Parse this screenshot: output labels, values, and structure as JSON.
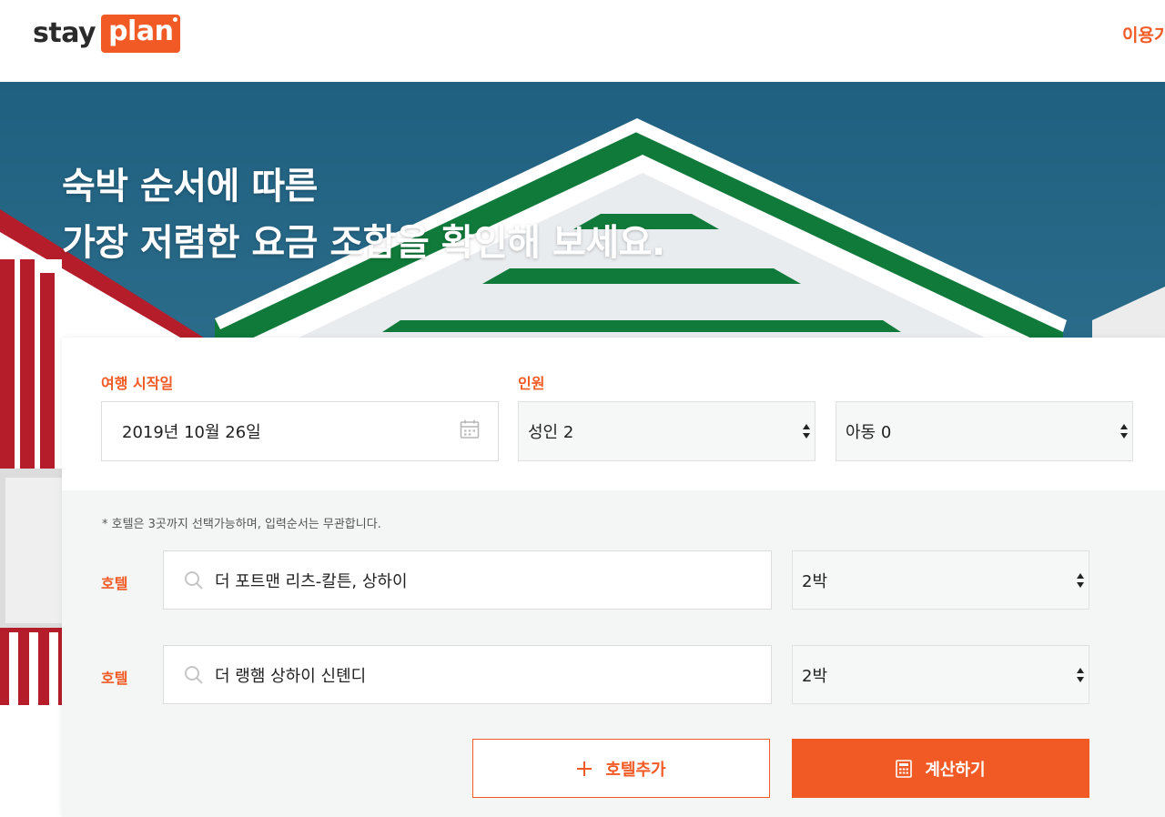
{
  "header": {
    "logo_text_1": "stay",
    "logo_text_2": "plan",
    "nav_link": "이용가"
  },
  "hero": {
    "title_line_1": "숙박 순서에 따른",
    "title_line_2": "가장 저렴한 요금 조합을 확인해 보세요."
  },
  "form": {
    "start_date_label": "여행 시작일",
    "start_date_value": "2019년 10월 26일",
    "guests_label": "인원",
    "adults_value": "성인 2",
    "children_value": "아동 0",
    "note": "* 호텔은 3곳까지 선택가능하며, 입력순서는 무관합니다.",
    "hotels": [
      {
        "label": "호텔",
        "name": "더 포트맨 리츠-칼튼, 상하이",
        "nights": "2박"
      },
      {
        "label": "호텔",
        "name": "더 랭햄 상하이 신톈디",
        "nights": "2박"
      }
    ],
    "add_hotel_label": "호텔추가",
    "calculate_label": "계산하기"
  },
  "colors": {
    "accent": "#f15a24",
    "hero_sky": "#2a6b8a"
  },
  "icons": [
    "calendar-icon",
    "search-icon",
    "updown-arrow-icon",
    "plus-icon",
    "calculator-icon"
  ]
}
